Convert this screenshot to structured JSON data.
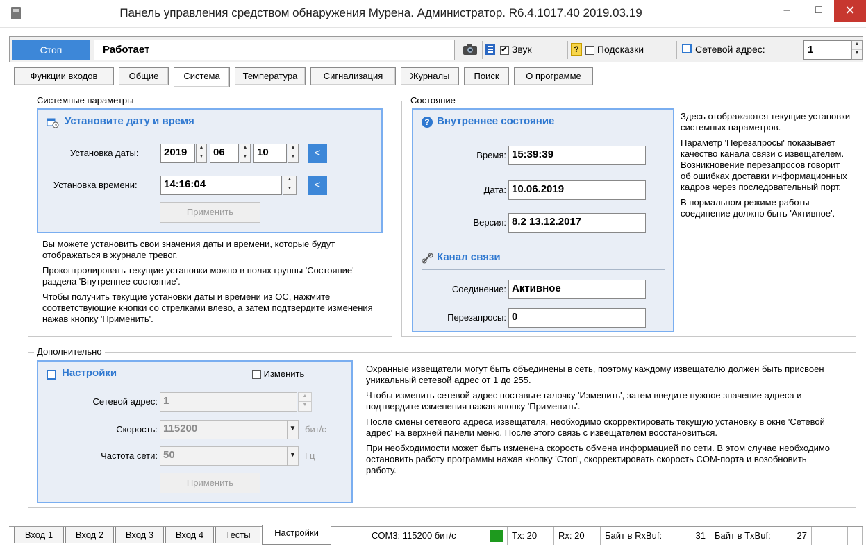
{
  "window": {
    "title": "Панель управления средством обнаружения Мурена. Администратор. R6.4.1017.40 2019.03.19",
    "minimize": "–",
    "maximize": "□",
    "close": "✕"
  },
  "toolbar": {
    "stop_label": "Стоп",
    "status_value": "Работает",
    "sound_label": "Звук",
    "sound_checked": true,
    "hints_label": "Подсказки",
    "hints_checked": false,
    "netaddr_label": "Сетевой адрес:",
    "netaddr_value": "1",
    "hint_icon": "?"
  },
  "tabs": [
    {
      "label": "Функции входов"
    },
    {
      "label": "Общие"
    },
    {
      "label": "Система",
      "active": true
    },
    {
      "label": "Температура"
    },
    {
      "label": "Сигнализация"
    },
    {
      "label": "Журналы"
    },
    {
      "label": "Поиск"
    },
    {
      "label": "О программе"
    }
  ],
  "system_params": {
    "group_label": "Системные параметры",
    "panel_title": "Установите дату и время",
    "date_label": "Установка даты:",
    "date_year": "2019",
    "date_month": "06",
    "date_day": "10",
    "time_label": "Установка времени:",
    "time_value": "14:16:04",
    "set_button": "<",
    "apply_button": "Применить",
    "help": [
      "Вы можете установить свои значения даты и времени, которые будут отображаться в журнале тревог.",
      "Проконтролировать текущие установки можно в полях группы 'Состояние' раздела 'Внутреннее состояние'.",
      "Чтобы получить текущие установки даты и времени из ОС, нажмите соответствующие кнопки со стрелками влево, а затем подтвердите изменения нажав кнопку 'Применить'."
    ]
  },
  "state": {
    "group_label": "Состояние",
    "internal_title": "Внутреннее состояние",
    "time_label": "Время:",
    "time_value": "15:39:39",
    "date_label": "Дата:",
    "date_value": "10.06.2019",
    "version_label": "Версия:",
    "version_value": "8.2 13.12.2017",
    "channel_title": "Канал связи",
    "connection_label": "Соединение:",
    "connection_value": "Активное",
    "retries_label": "Перезапросы:",
    "retries_value": "0",
    "help": [
      "Здесь отображаются текущие установки системных параметров.",
      "Параметр 'Перезапросы' показывает качество канала связи с извещателем. Возникновение перезапросов говорит об ошибках доставки информационных кадров через последовательный порт.",
      "В нормальном режиме работы соединение должно быть 'Активное'."
    ]
  },
  "additional": {
    "group_label": "Дополнительно",
    "panel_title": "Настройки",
    "change_label": "Изменить",
    "change_checked": false,
    "netaddr_label": "Сетевой адрес:",
    "netaddr_value": "1",
    "speed_label": "Скорость:",
    "speed_value": "115200",
    "speed_unit": "бит/с",
    "freq_label": "Частота сети:",
    "freq_value": "50",
    "freq_unit": "Гц",
    "apply_button": "Применить",
    "help": [
      "Охранные извещатели могут быть объединены в сеть, поэтому каждому извещателю должен быть присвоен уникальный сетевой адрес от 1 до 255.",
      "Чтобы изменить сетевой адрес поставьте галочку 'Изменить', затем введите нужное значение адреса и подтвердите изменения нажав кнопку 'Применить'.",
      "После смены сетевого адреса извещателя, необходимо скорректировать текущую установку в окне 'Сетевой адрес' на верхней панели меню. После этого связь с извещателем восстановиться.",
      "При необходимости может быть изменена скорость обмена информацией по сети. В этом случае необходимо остановить работу программы нажав кнопку 'Стоп', скорректировать скорость COM-порта и возобновить работу."
    ]
  },
  "bottom_tabs": [
    {
      "label": "Вход 1"
    },
    {
      "label": "Вход 2"
    },
    {
      "label": "Вход 3"
    },
    {
      "label": "Вход 4"
    },
    {
      "label": "Тесты"
    },
    {
      "label": "Настройки",
      "active": true
    }
  ],
  "statusbar": {
    "port": "COM3: 115200 бит/с",
    "tx": "Tx: 20",
    "rx": "Rx: 20",
    "rxbuf_label": "Байт в RxBuf:",
    "rxbuf_value": "31",
    "txbuf_label": "Байт в TxBuf:",
    "txbuf_value": "27",
    "indicator_color": "#1e9a1e"
  },
  "colors": {
    "accent": "#3d87d8",
    "panel_bg": "#e9eef6",
    "panel_title": "#2f78d0",
    "close_bg": "#c7372f"
  }
}
